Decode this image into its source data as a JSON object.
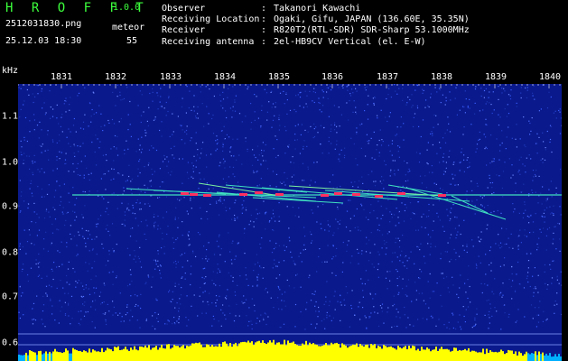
{
  "app": {
    "title": "H R O F F T",
    "version": "1.0.0"
  },
  "capture": {
    "filename": "2512031830.png",
    "datetime": "25.12.03 18:30",
    "meteor_label": "meteor",
    "meteor_count": "55"
  },
  "info": [
    {
      "key": "Observer",
      "value": "Takanori Kawachi"
    },
    {
      "key": "Receiving Location",
      "value": "Ogaki, Gifu, JAPAN (136.60E, 35.35N)"
    },
    {
      "key": "Receiver",
      "value": "R820T2(RTL-SDR) SDR-Sharp 53.1000MHz"
    },
    {
      "key": "Receiving antenna",
      "value": "2el-HB9CV Vertical (el. E-W)"
    }
  ],
  "axis": {
    "unit": "kHz",
    "x_ticks": [
      "1831",
      "1832",
      "1833",
      "1834",
      "1835",
      "1836",
      "1837",
      "1838",
      "1839",
      "1840"
    ],
    "y_ticks": [
      "1.1",
      "1.0",
      "0.9",
      "0.8",
      "0.7",
      "0.6"
    ]
  },
  "colors": {
    "background": "#000000",
    "noise_base": "#0a1a8c",
    "title": "#3cff3c",
    "carrier": "#40e0c0",
    "meteor_hot": "#ff3060",
    "histogram": "#ffff00",
    "histogram_base": "#00b0ff"
  }
}
